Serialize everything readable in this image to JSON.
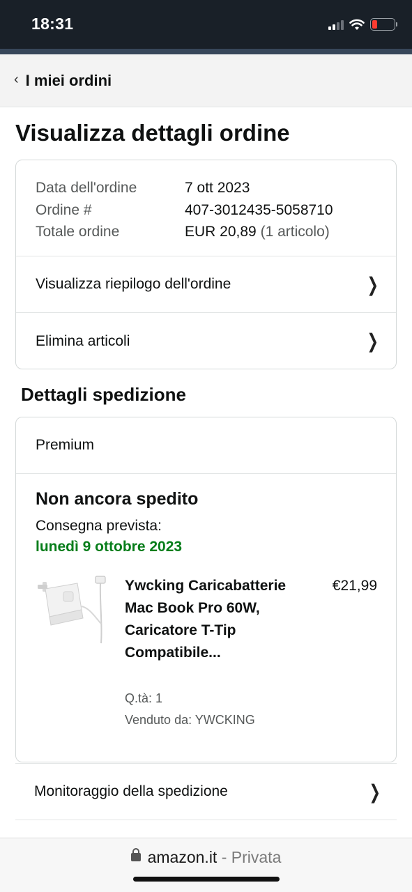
{
  "status_bar": {
    "time": "18:31",
    "icons": [
      "cellular-signal-icon",
      "wifi-icon",
      "battery-low-icon"
    ],
    "battery_level": 0.22,
    "battery_color": "#ff3b30"
  },
  "back_nav": {
    "icon": "chevron-left-icon",
    "label": "I miei ordini"
  },
  "page": {
    "title": "Visualizza dettagli ordine"
  },
  "order": {
    "rows": [
      {
        "label": "Data dell'ordine",
        "value": "7 ott 2023"
      },
      {
        "label": "Ordine #",
        "value": "407-3012435-5058710"
      },
      {
        "label": "Totale ordine",
        "value": "EUR 20,89",
        "note": "(1 articolo)"
      }
    ],
    "links": [
      {
        "label": "Visualizza riepilogo dell'ordine",
        "icon": "chevron-right-icon"
      },
      {
        "label": "Elimina articoli",
        "icon": "chevron-right-icon"
      }
    ]
  },
  "shipment": {
    "section_title": "Dettagli spedizione",
    "shipping_type": "Premium",
    "status": "Non ancora spedito",
    "delivery_label": "Consegna prevista:",
    "delivery_date": "lunedì 9 ottobre 2023",
    "delivery_color": "#067d1a",
    "item": {
      "image_icon": "charger-product-image",
      "title": "Ywcking Caricabatterie Mac Book Pro 60W, Caricatore T-Tip Compatibile...",
      "price": "€21,99",
      "qty": "Q.tà: 1",
      "seller": "Venduto da: YWCKING"
    },
    "track_label": "Monitoraggio della spedizione"
  },
  "browser": {
    "domain": "amazon.it",
    "separator": " - ",
    "mode": "Privata",
    "lock_icon": "lock-icon"
  }
}
